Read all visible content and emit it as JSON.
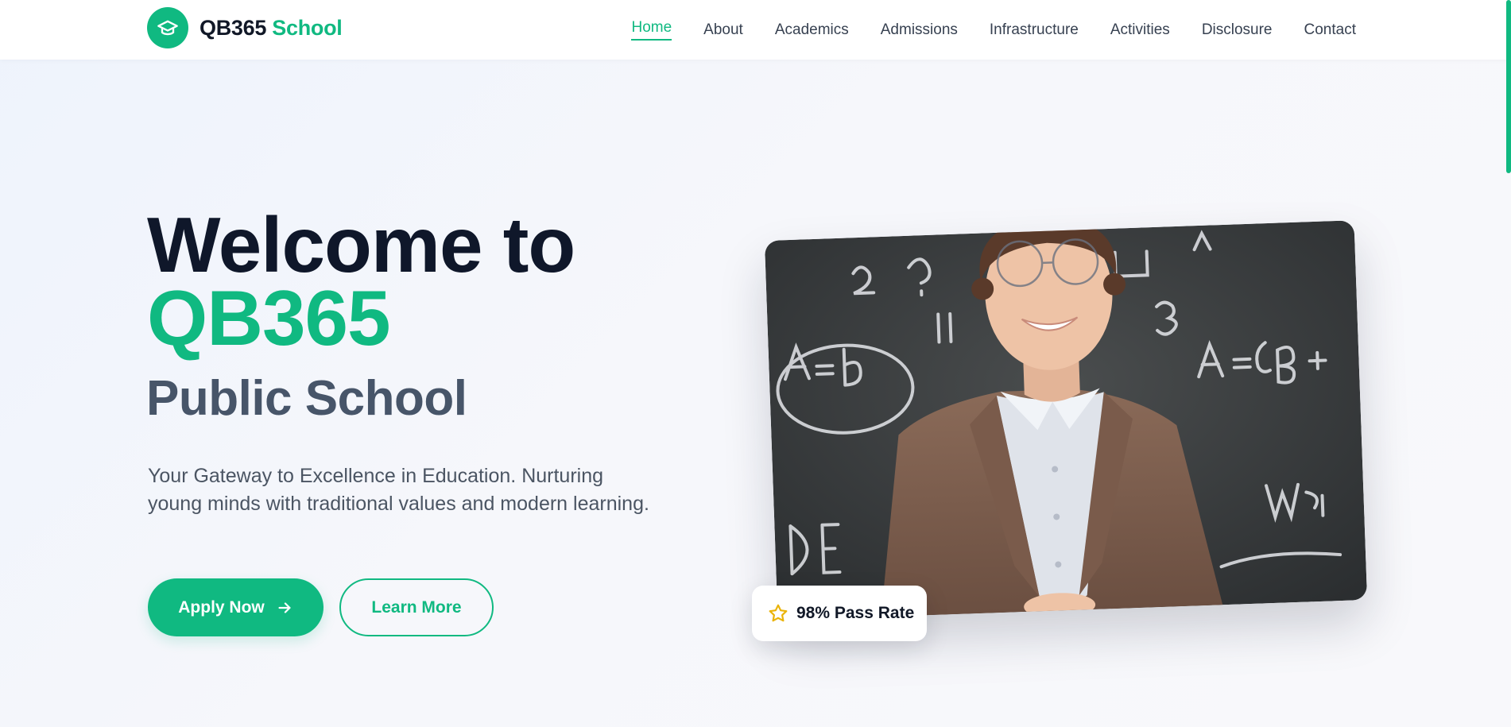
{
  "brand": {
    "name": "QB365",
    "accent_word": "School",
    "icon": "graduation-cap-icon",
    "accent_color": "#10b981"
  },
  "nav": {
    "items": [
      {
        "label": "Home",
        "active": true
      },
      {
        "label": "About",
        "active": false
      },
      {
        "label": "Academics",
        "active": false
      },
      {
        "label": "Admissions",
        "active": false
      },
      {
        "label": "Infrastructure",
        "active": false
      },
      {
        "label": "Activities",
        "active": false
      },
      {
        "label": "Disclosure",
        "active": false
      },
      {
        "label": "Contact",
        "active": false
      }
    ]
  },
  "hero": {
    "title_line1": "Welcome to",
    "title_accent": "QB365",
    "subtitle": "Public School",
    "description": "Your Gateway to Excellence in Education. Nurturing young minds with traditional values and modern learning.",
    "primary_button": "Apply Now",
    "primary_icon": "arrow-right-icon",
    "secondary_button": "Learn More"
  },
  "stat_badge": {
    "icon": "star-icon",
    "text": "98% Pass Rate",
    "icon_color": "#eab308"
  },
  "colors": {
    "heading": "#0f172a",
    "subheading": "#475569",
    "body_text": "#4b5563",
    "accent": "#10b981"
  }
}
